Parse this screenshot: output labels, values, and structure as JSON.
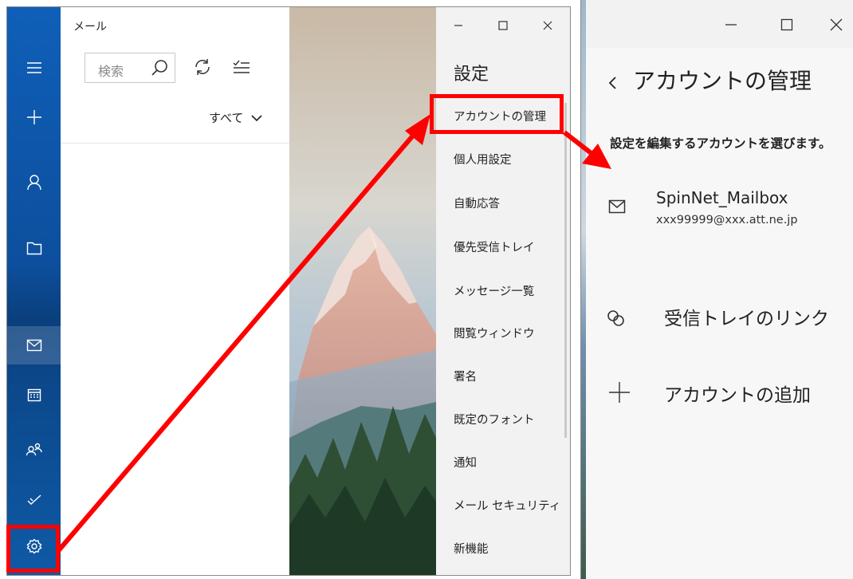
{
  "mail_window": {
    "app_title": "メール",
    "search": {
      "placeholder": "検索"
    },
    "filter_label": "すべて",
    "rail": [
      "menu-icon",
      "new-mail-icon",
      "account-icon",
      "folder-icon",
      "mail-icon",
      "calendar-icon",
      "people-icon",
      "todo-icon",
      "settings-icon"
    ],
    "window_controls": [
      "–",
      "☐",
      "✕"
    ]
  },
  "settings": {
    "title": "設定",
    "items": [
      "アカウントの管理",
      "個人用設定",
      "自動応答",
      "優先受信トレイ",
      "メッセージ一覧",
      "閲覧ウィンドウ",
      "署名",
      "既定のフォント",
      "通知",
      "メール セキュリティ",
      "新機能"
    ]
  },
  "manage_accounts": {
    "title": "アカウントの管理",
    "prompt": "設定を編集するアカウントを選びます。",
    "account": {
      "name": "SpinNet_Mailbox",
      "email": "xxx99999@xxx.att.ne.jp"
    },
    "link_inboxes": "受信トレイのリンク",
    "add_account": "アカウントの追加"
  },
  "colors": {
    "accent": "#0f5fb8",
    "highlight": "#ff0000"
  }
}
